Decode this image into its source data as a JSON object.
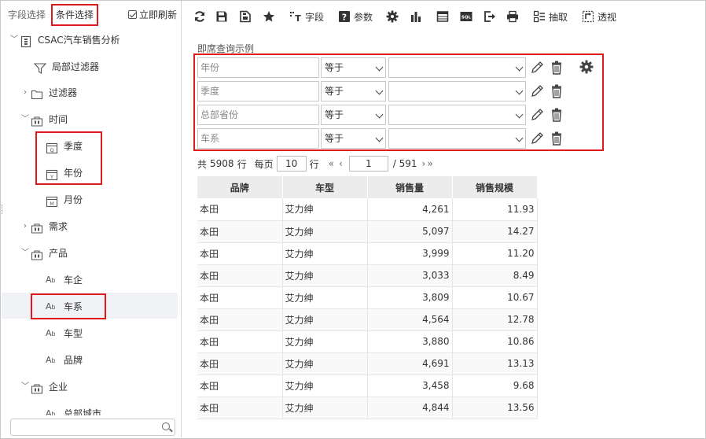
{
  "left_panel": {
    "tab_field_select": "字段选择",
    "tab_condition_select": "条件选择",
    "refresh_label": "立即刷新",
    "tree": {
      "root": "CSAC汽车销售分析",
      "local_filter": "局部过滤器",
      "filter": "过滤器",
      "time": "时间",
      "quarter": "季度",
      "year": "年份",
      "month": "月份",
      "demand": "需求",
      "product": "产品",
      "company": "车企",
      "series": "车系",
      "model": "车型",
      "brand": "品牌",
      "enterprise": "企业",
      "hq_city": "总部城市"
    },
    "search_placeholder": ""
  },
  "toolbar": {
    "field_label": "字段",
    "param_label": "参数",
    "extract_label": "抽取",
    "pivot_label": "透视",
    "sql_label": "SQL"
  },
  "query": {
    "title": "即席查询示例",
    "rows": [
      {
        "field": "年份",
        "op": "等于",
        "value": ""
      },
      {
        "field": "季度",
        "op": "等于",
        "value": ""
      },
      {
        "field": "总部省份",
        "op": "等于",
        "value": ""
      },
      {
        "field": "车系",
        "op": "等于",
        "value": ""
      }
    ]
  },
  "pager": {
    "total_prefix": "共",
    "total_rows": "5908",
    "total_suffix": "行",
    "per_page_label": "每页",
    "per_page": "10",
    "row_unit": "行",
    "current_page": "1",
    "page_count": "/ 591"
  },
  "table": {
    "headers": [
      "品牌",
      "车型",
      "销售量",
      "销售规模"
    ],
    "rows": [
      [
        "本田",
        "艾力绅",
        "4,261",
        "11.93"
      ],
      [
        "本田",
        "艾力绅",
        "5,097",
        "14.27"
      ],
      [
        "本田",
        "艾力绅",
        "3,999",
        "11.20"
      ],
      [
        "本田",
        "艾力绅",
        "3,033",
        "8.49"
      ],
      [
        "本田",
        "艾力绅",
        "3,809",
        "10.67"
      ],
      [
        "本田",
        "艾力绅",
        "4,564",
        "12.78"
      ],
      [
        "本田",
        "艾力绅",
        "3,880",
        "10.86"
      ],
      [
        "本田",
        "艾力绅",
        "4,691",
        "13.13"
      ],
      [
        "本田",
        "艾力绅",
        "3,458",
        "9.68"
      ],
      [
        "本田",
        "艾力绅",
        "4,844",
        "13.56"
      ]
    ]
  },
  "colors": {
    "highlight": "#e0191b",
    "header_bg": "#ececec",
    "selected_row": "#f0f2f5"
  }
}
